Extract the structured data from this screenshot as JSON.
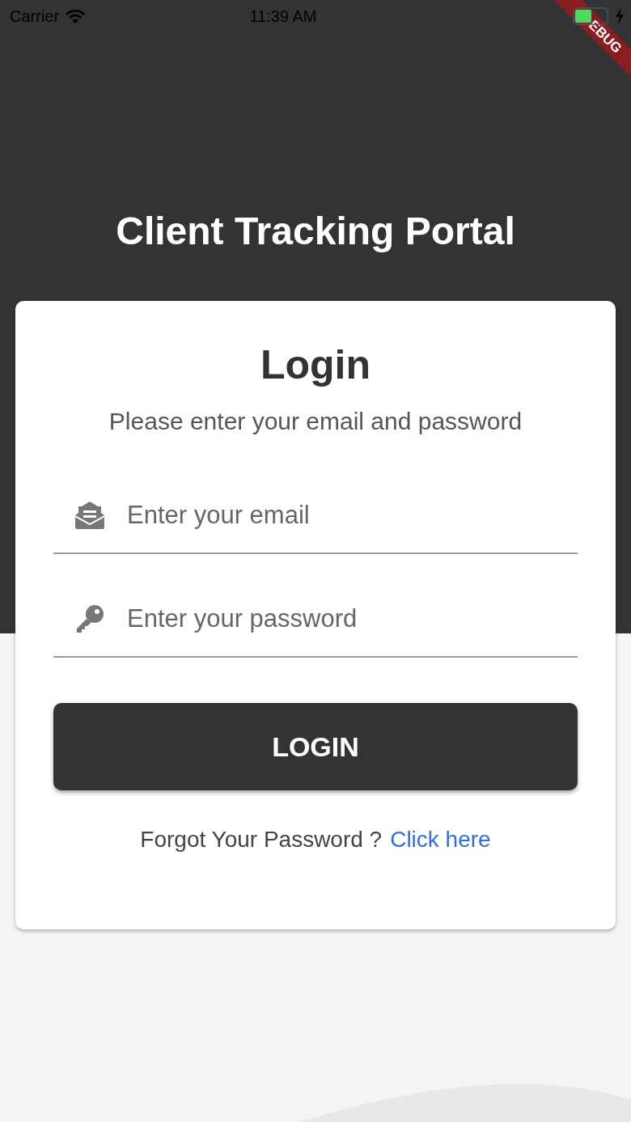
{
  "status_bar": {
    "carrier": "Carrier",
    "time": "11:39 AM"
  },
  "debug_banner": "EBUG",
  "header": {
    "title": "Client Tracking Portal"
  },
  "card": {
    "title": "Login",
    "subtitle": "Please enter your email and password",
    "fields": [
      {
        "kind": "email",
        "placeholder": "Enter your email"
      },
      {
        "kind": "password",
        "placeholder": "Enter your password"
      }
    ],
    "button": "LOGIN",
    "forgot": {
      "text": "Forgot Your Password ?",
      "link": "Click here"
    }
  }
}
